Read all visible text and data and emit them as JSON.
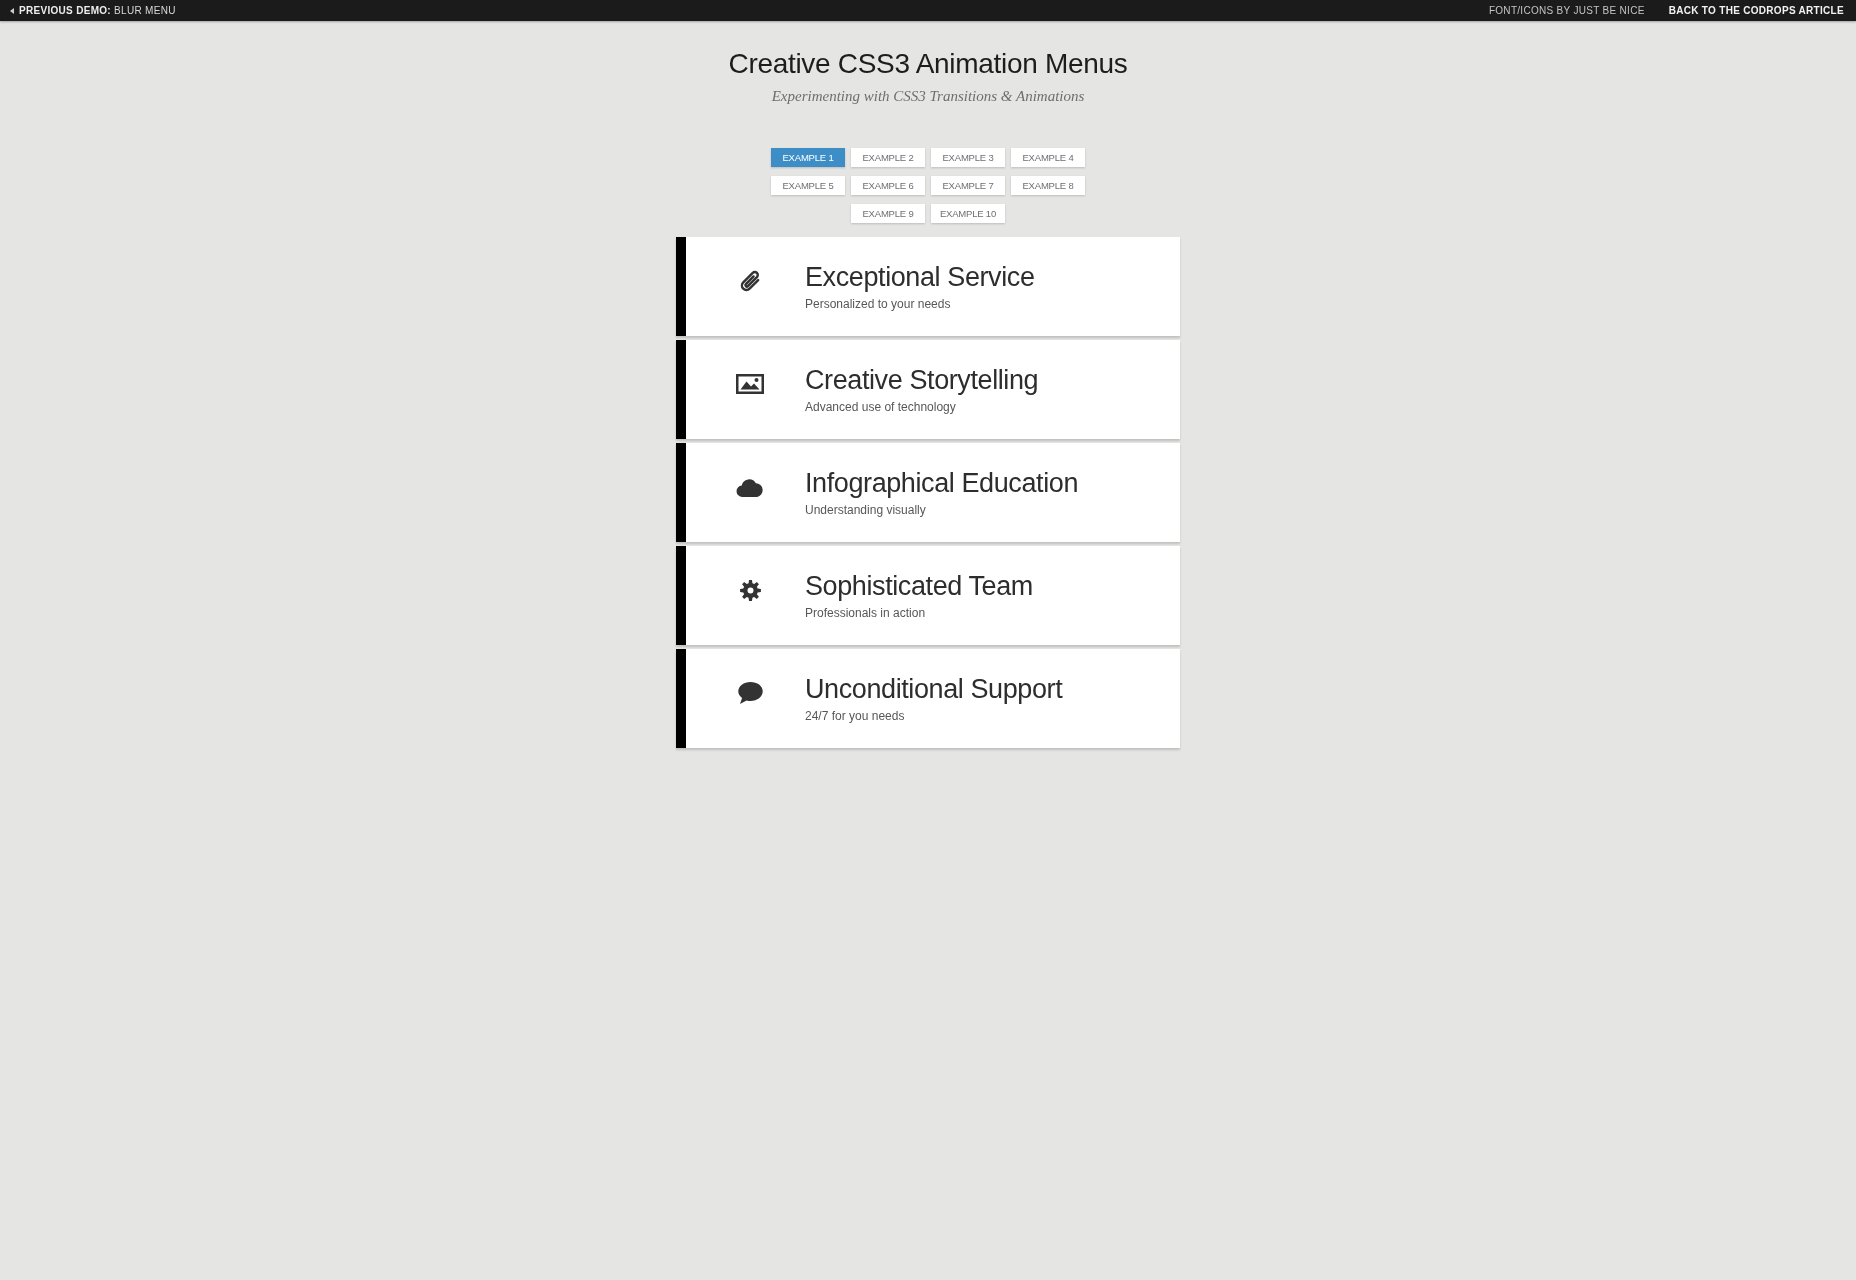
{
  "top_bar": {
    "previous_demo": "**PREVIOUS DEMO:** BLUR MENU",
    "credit": "FONT/ICONS BY JUST BE NICE",
    "back_link": "BACK TO THE CODROPS ARTICLE"
  },
  "header": {
    "title": "Creative CSS3 Animation Menus",
    "subtitle": "Experimenting with CSS3 Transitions & Animations"
  },
  "example_tabs": [
    {
      "label": "EXAMPLE 1",
      "selected": true
    },
    {
      "label": "EXAMPLE 2",
      "selected": false
    },
    {
      "label": "EXAMPLE 3",
      "selected": false
    },
    {
      "label": "EXAMPLE 4",
      "selected": false
    },
    {
      "label": "EXAMPLE 5",
      "selected": false
    },
    {
      "label": "EXAMPLE 6",
      "selected": false
    },
    {
      "label": "EXAMPLE 7",
      "selected": false
    },
    {
      "label": "EXAMPLE 8",
      "selected": false
    },
    {
      "label": "EXAMPLE 9",
      "selected": false
    },
    {
      "label": "EXAMPLE 10",
      "selected": false
    }
  ],
  "menu": [
    {
      "title": "Exceptional Service",
      "subtitle": "Personalized to your needs"
    },
    {
      "title": "Creative Storytelling",
      "subtitle": "Advanced use of technology"
    },
    {
      "title": "Infographical Education",
      "subtitle": "Understanding visually"
    },
    {
      "title": "Sophisticated Team",
      "subtitle": "Professionals in action"
    },
    {
      "title": "Unconditional Support",
      "subtitle": "24/7 for you needs"
    }
  ]
}
